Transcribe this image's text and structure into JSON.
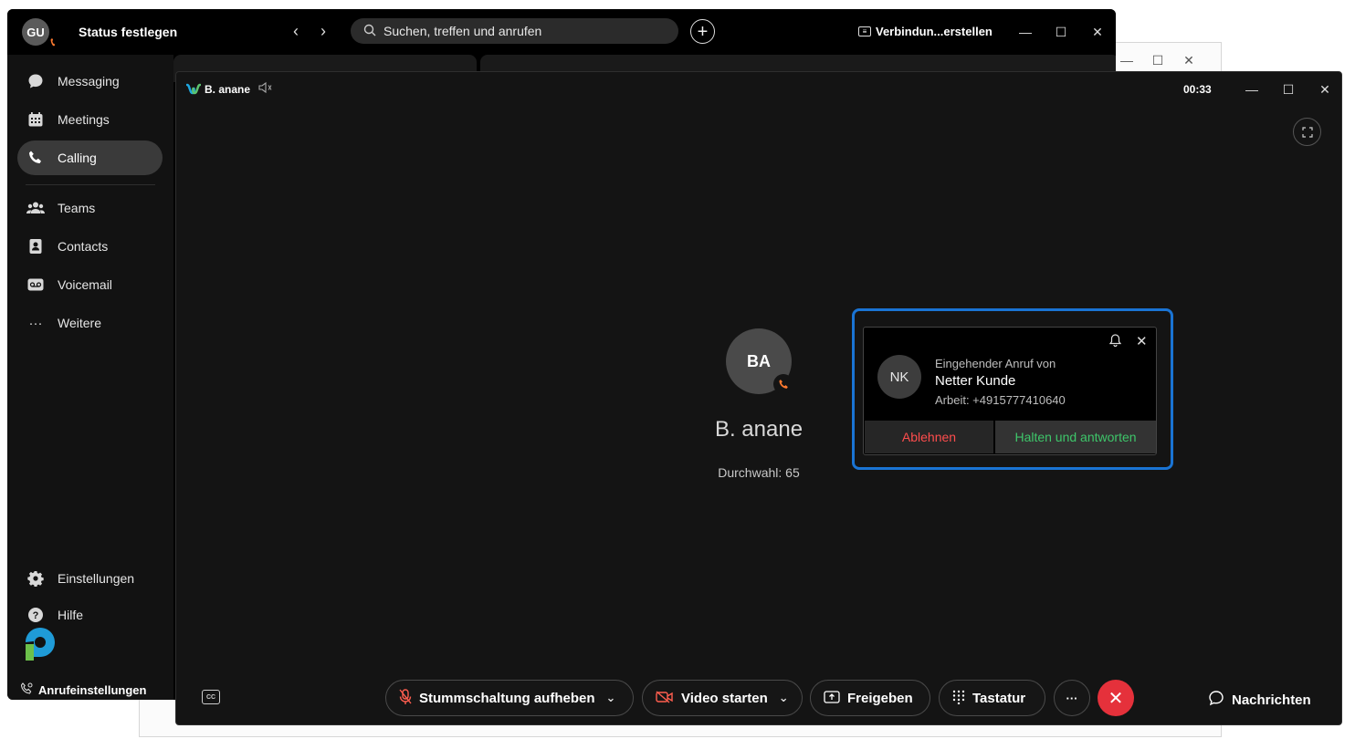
{
  "bg_window": {
    "minimize": "—",
    "maximize": "☐",
    "close": "✕"
  },
  "titlebar": {
    "avatar_initials": "GU",
    "status_label": "Status festlegen",
    "back": "‹",
    "forward": "›",
    "search_placeholder": "Suchen, treffen und anrufen",
    "add": "+",
    "connect_label": "Verbindun...erstellen",
    "minimize": "—",
    "maximize": "☐",
    "close": "✕"
  },
  "sidebar": {
    "items": [
      {
        "label": "Messaging",
        "icon": "chat-bubble-icon"
      },
      {
        "label": "Meetings",
        "icon": "calendar-icon"
      },
      {
        "label": "Calling",
        "icon": "phone-icon",
        "active": true
      },
      {
        "label": "Teams",
        "icon": "people-icon"
      },
      {
        "label": "Contacts",
        "icon": "contact-card-icon"
      },
      {
        "label": "Voicemail",
        "icon": "voicemail-icon"
      },
      {
        "label": "Weitere",
        "icon": "more-dots-icon"
      }
    ],
    "settings_label": "Einstellungen",
    "help_label": "Hilfe",
    "call_settings_label": "Anrufeinstellungen"
  },
  "call_window": {
    "title": "B. anane",
    "timer": "00:33",
    "minimize": "—",
    "maximize": "☐",
    "close": "✕",
    "remote": {
      "initials": "BA",
      "name": "B. anane",
      "extension": "Durchwahl: 65"
    },
    "toolbar": {
      "cc_label": "CC",
      "unmute_label": "Stummschaltung aufheben",
      "video_label": "Video starten",
      "share_label": "Freigeben",
      "keypad_label": "Tastatur",
      "more_label": "···",
      "messages_label": "Nachrichten"
    }
  },
  "incoming": {
    "initials": "NK",
    "heading": "Eingehender Anruf von",
    "caller": "Netter Kunde",
    "number": "Arbeit: +4915777410640",
    "decline_label": "Ablehnen",
    "hold_answer_label": "Halten und antworten"
  },
  "colors": {
    "accent_orange": "#ff7a2f",
    "end_call_red": "#e5313b",
    "decline_red": "#ff4d4d",
    "answer_green": "#3ec66a",
    "focus_blue": "#1a74d4"
  }
}
